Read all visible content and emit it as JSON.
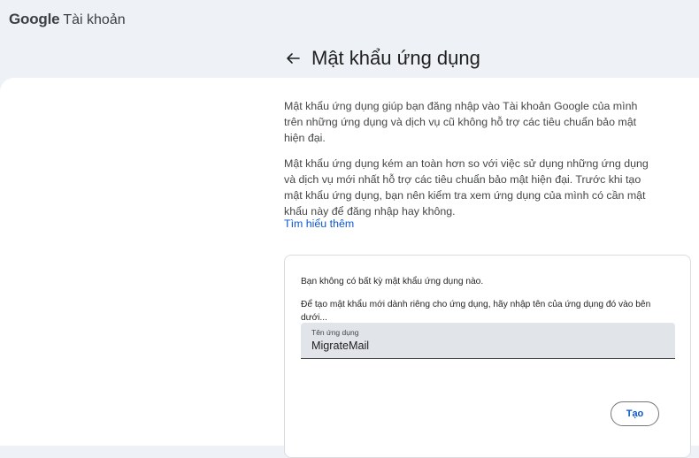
{
  "brand": {
    "google": "Google",
    "product": "Tài khoản"
  },
  "header": {
    "back_icon": "arrow-left-icon",
    "title": "Mật khẩu ứng dụng"
  },
  "description": {
    "paragraph1": "Mật khẩu ứng dụng giúp bạn đăng nhập vào Tài khoản Google của mình trên những ứng dụng và dịch vụ cũ không hỗ trợ các tiêu chuẩn bảo mật hiện đại.",
    "paragraph2": "Mật khẩu ứng dụng kém an toàn hơn so với việc sử dụng những ứng dụng và dịch vụ mới nhất hỗ trợ các tiêu chuẩn bảo mật hiện đại. Trước khi tạo mật khẩu ứng dụng, bạn nên kiểm tra xem ứng dụng của mình có cần mật khẩu này để đăng nhập hay không.",
    "learn_more": "Tìm hiểu thêm"
  },
  "card": {
    "no_passwords": "Bạn không có bất kỳ mật khẩu ứng dụng nào.",
    "instruction": "Để tạo mật khẩu mới dành riêng cho ứng dụng, hãy nhập tên của ứng dụng đó vào bên dưới...",
    "field_label": "Tên ứng dụng",
    "field_value": "MigrateMail",
    "create_button": "Tạo"
  },
  "colors": {
    "background": "#eef2f7",
    "link": "#0b57d0",
    "field": "#e1e5ea"
  }
}
